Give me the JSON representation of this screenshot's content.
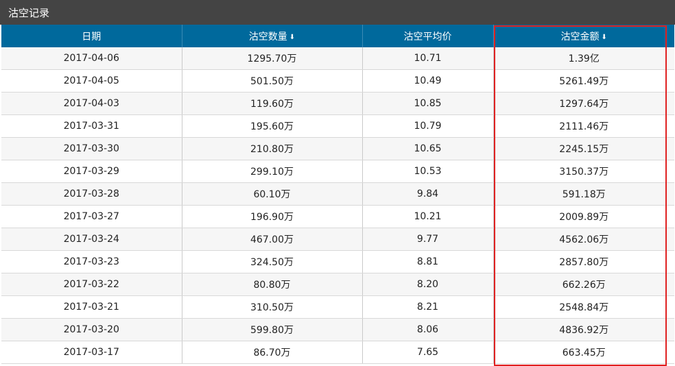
{
  "panel": {
    "title": "沽空记录"
  },
  "columns": [
    {
      "label": "日期",
      "sort_icon": ""
    },
    {
      "label": "沽空数量",
      "sort_icon": "⬇"
    },
    {
      "label": "沽空平均价",
      "sort_icon": ""
    },
    {
      "label": "沽空金额",
      "sort_icon": "⬇"
    }
  ],
  "rows": [
    [
      "2017-04-06",
      "1295.70万",
      "10.71",
      "1.39亿"
    ],
    [
      "2017-04-05",
      "501.50万",
      "10.49",
      "5261.49万"
    ],
    [
      "2017-04-03",
      "119.60万",
      "10.85",
      "1297.64万"
    ],
    [
      "2017-03-31",
      "195.60万",
      "10.79",
      "2111.46万"
    ],
    [
      "2017-03-30",
      "210.80万",
      "10.65",
      "2245.15万"
    ],
    [
      "2017-03-29",
      "299.10万",
      "10.53",
      "3150.37万"
    ],
    [
      "2017-03-28",
      "60.10万",
      "9.84",
      "591.18万"
    ],
    [
      "2017-03-27",
      "196.90万",
      "10.21",
      "2009.89万"
    ],
    [
      "2017-03-24",
      "467.00万",
      "9.77",
      "4562.06万"
    ],
    [
      "2017-03-23",
      "324.50万",
      "8.81",
      "2857.80万"
    ],
    [
      "2017-03-22",
      "80.80万",
      "8.20",
      "662.26万"
    ],
    [
      "2017-03-21",
      "310.50万",
      "8.21",
      "2548.84万"
    ],
    [
      "2017-03-20",
      "599.80万",
      "8.06",
      "4836.92万"
    ],
    [
      "2017-03-17",
      "86.70万",
      "7.65",
      "663.45万"
    ]
  ],
  "colors": {
    "header_bg": "#00699c",
    "title_bg": "#444444",
    "highlight_border": "#e02020"
  }
}
